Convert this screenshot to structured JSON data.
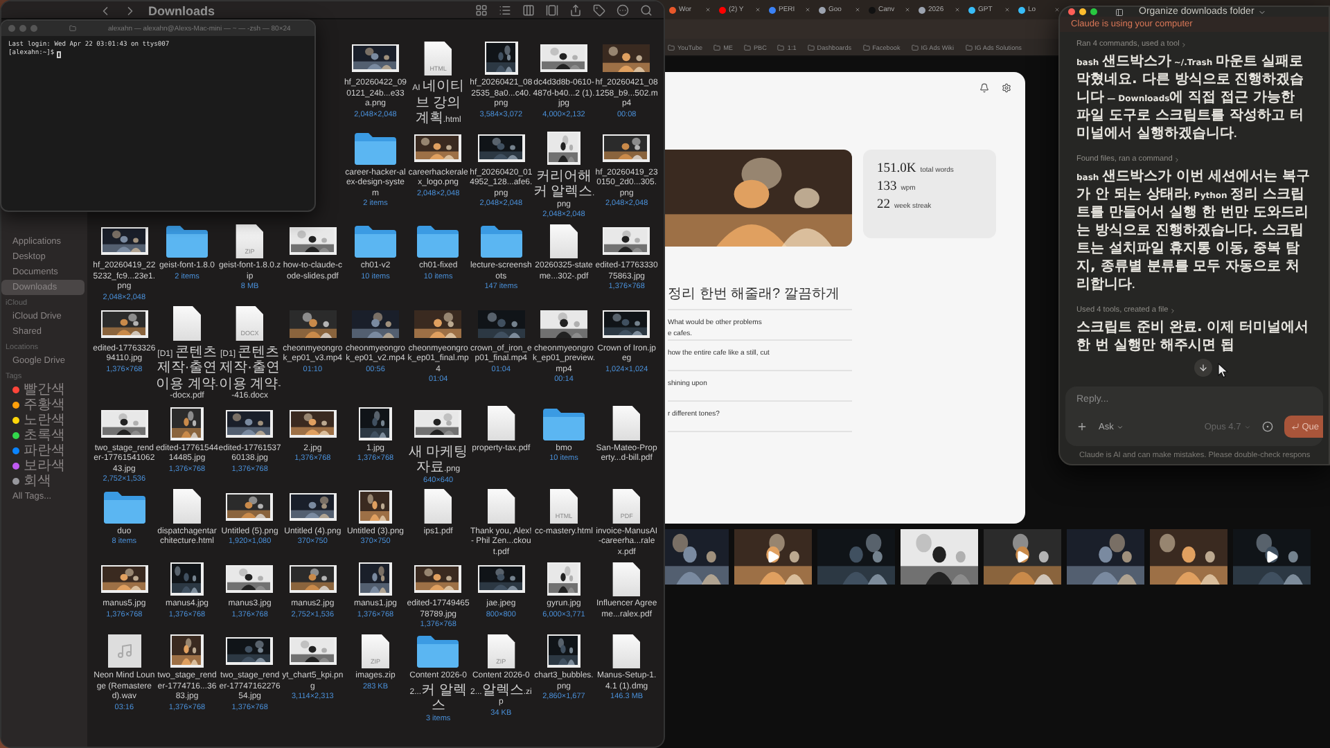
{
  "finder": {
    "title": "Downloads",
    "sidebar": [
      {
        "kind": "item",
        "label": "Applications",
        "selected": false
      },
      {
        "kind": "item",
        "label": "Desktop",
        "selected": false
      },
      {
        "kind": "item",
        "label": "Documents",
        "selected": false
      },
      {
        "kind": "item",
        "label": "Downloads",
        "selected": true
      },
      {
        "kind": "header",
        "label": "iCloud"
      },
      {
        "kind": "item",
        "label": "iCloud Drive",
        "selected": false
      },
      {
        "kind": "item",
        "label": "Shared",
        "selected": false
      },
      {
        "kind": "header",
        "label": "Locations"
      },
      {
        "kind": "item",
        "label": "Google Drive",
        "selected": false
      },
      {
        "kind": "header",
        "label": "Tags"
      },
      {
        "kind": "tag",
        "label": "빨간색",
        "color": "#ff453a"
      },
      {
        "kind": "tag",
        "label": "주황색",
        "color": "#ff9f0a"
      },
      {
        "kind": "tag",
        "label": "노란색",
        "color": "#ffd60a"
      },
      {
        "kind": "tag",
        "label": "초록색",
        "color": "#32d74b"
      },
      {
        "kind": "tag",
        "label": "파란색",
        "color": "#0a84ff"
      },
      {
        "kind": "tag",
        "label": "보라색",
        "color": "#bf5af2"
      },
      {
        "kind": "tag",
        "label": "회색",
        "color": "#98989d"
      },
      {
        "kind": "item",
        "label": "All Tags...",
        "selected": false
      }
    ],
    "rows": [
      {
        "items": [
          {
            "name": "hf_20260422_090121_24b...e33a.png",
            "meta": "2,048×2,048"
          },
          {
            "kind": "doc",
            "name": "AI 네이티브 강의 계획.html",
            "badge": "HTML"
          },
          {
            "name": "hf_20260421_082535_8a0...c40.png",
            "meta": "3,584×3,072"
          },
          {
            "name": "dc4d3d8b-0610-487d-b40...2 (1).jpg",
            "meta": "4,000×2,132"
          },
          {
            "kind": "video",
            "name": "hf_20260421_081258_b9...502.mp4",
            "meta": "00:08"
          }
        ]
      },
      {
        "items": [
          {
            "kind": "folder",
            "name": "career-hacker-alex-design-system",
            "meta": "2 items"
          },
          {
            "name": "careerhackeralex_logo.png",
            "meta": "2,048×2,048"
          },
          {
            "name": "hf_20260420_014952_128...afe6.png",
            "meta": "2,048×2,048"
          },
          {
            "name": "커리어해커 알렉스.png",
            "meta": "2,048×2,048"
          },
          {
            "name": "hf_20260419_230150_2d0...305.png",
            "meta": "2,048×2,048"
          }
        ]
      },
      {
        "items": [
          {
            "name": "hf_20260419_225232_fc9...23e1.png",
            "meta": "2,048×2,048"
          },
          {
            "kind": "folder",
            "name": "geist-font-1.8.0",
            "meta": "2 items"
          },
          {
            "kind": "doc",
            "name": "geist-font-1.8.0.zip",
            "badge": "ZIP",
            "meta": "8 MB"
          },
          {
            "name": "how-to-claude-code-slides.pdf"
          },
          {
            "kind": "folder",
            "name": "ch01-v2",
            "meta": "10 items"
          },
          {
            "kind": "folder",
            "name": "ch01-fixed",
            "meta": "10 items"
          },
          {
            "kind": "folder",
            "name": "lecture-screenshots",
            "meta": "147 items"
          },
          {
            "kind": "doc",
            "name": "20260325-stateme...302-.pdf"
          },
          {
            "name": "edited-1776333075863.jpg",
            "meta": "1,376×768"
          }
        ]
      },
      {
        "items": [
          {
            "name": "edited-1776332694110.jpg",
            "meta": "1,376×768"
          },
          {
            "kind": "doc",
            "name": "[D1] 콘텐츠 제작·출연 이용 계약--docx.pdf"
          },
          {
            "kind": "doc",
            "name": "[D1] 콘텐츠 제작·출연 이용 계약--416.docx",
            "badge": "DOCX"
          },
          {
            "kind": "video",
            "name": "cheonmyeongrok_ep01_v3.mp4",
            "meta": "01:10"
          },
          {
            "kind": "video",
            "name": "cheonmyeongrok_ep01_v2.mp4",
            "meta": "00:56"
          },
          {
            "kind": "video",
            "name": "cheonmyeongrok_ep01_final.mp4",
            "meta": "01:04"
          },
          {
            "kind": "video",
            "name": "crown_of_iron_ep01_final.mp4",
            "meta": "01:04"
          },
          {
            "kind": "video",
            "name": "cheonmyeongrok_ep01_preview.mp4",
            "meta": "00:14"
          },
          {
            "name": "Crown of Iron.jpeg",
            "meta": "1,024×1,024"
          }
        ]
      },
      {
        "items": [
          {
            "name": "two_stage_render-1776154106243.jpg",
            "meta": "2,752×1,536"
          },
          {
            "name": "edited-1776154414485.jpg",
            "meta": "1,376×768"
          },
          {
            "name": "edited-1776153760138.jpg",
            "meta": "1,376×768"
          },
          {
            "name": "2.jpg",
            "meta": "1,376×768"
          },
          {
            "name": "1.jpg",
            "meta": "1,376×768"
          },
          {
            "name": "새 마케팅 자료.png",
            "meta": "640×640"
          },
          {
            "kind": "doc",
            "name": "property-tax.pdf"
          },
          {
            "kind": "folder",
            "name": "bmo",
            "meta": "10 items"
          },
          {
            "kind": "doc",
            "name": "San-Mateo-Property...d-bill.pdf"
          }
        ]
      },
      {
        "items": [
          {
            "kind": "folder",
            "name": "duo",
            "meta": "8 items"
          },
          {
            "kind": "doc",
            "name": "dispatchagentarchitecture.html"
          },
          {
            "name": "Untitled (5).png",
            "meta": "1,920×1,080"
          },
          {
            "name": "Untitled (4).png",
            "meta": "370×750"
          },
          {
            "name": "Untitled (3).png",
            "meta": "370×750"
          },
          {
            "kind": "doc",
            "name": "ips1.pdf"
          },
          {
            "kind": "doc",
            "name": "Thank you, Alex! - Phil Zen...ckout.pdf"
          },
          {
            "kind": "doc",
            "name": "cc-mastery.html",
            "badge": "HTML"
          },
          {
            "kind": "doc",
            "name": "invoice-ManusAI-careerha...ralex.pdf",
            "badge": "PDF"
          }
        ]
      },
      {
        "items": [
          {
            "name": "manus5.jpg",
            "meta": "1,376×768"
          },
          {
            "name": "manus4.jpg",
            "meta": "1,376×768"
          },
          {
            "name": "manus3.jpg",
            "meta": "1,376×768"
          },
          {
            "name": "manus2.jpg",
            "meta": "2,752×1,536"
          },
          {
            "name": "manus1.jpg",
            "meta": "1,376×768"
          },
          {
            "name": "edited-1774946578789.jpg",
            "meta": "1,376×768"
          },
          {
            "name": "jae.jpeg",
            "meta": "800×800"
          },
          {
            "name": "gyrun.jpg",
            "meta": "6,000×3,771"
          },
          {
            "kind": "doc",
            "name": "Influencer Agreeme...ralex.pdf"
          }
        ]
      },
      {
        "items": [
          {
            "kind": "audio",
            "name": "Neon Mind Lounge (Remastered).wav",
            "meta": "03:16"
          },
          {
            "name": "two_stage_render-1774716...3683.jpg",
            "meta": "1,376×768"
          },
          {
            "name": "two_stage_render-1774716227654.jpg",
            "meta": "1,376×768"
          },
          {
            "name": "yt_chart5_kpi.png",
            "meta": "3,114×2,313"
          },
          {
            "kind": "doc",
            "name": "images.zip",
            "badge": "ZIP",
            "meta": "283 KB"
          },
          {
            "kind": "folder",
            "name": "Content 2026-02...커 알렉스",
            "meta": "3 items"
          },
          {
            "kind": "doc",
            "name": "Content 2026-02...알렉스.zip",
            "badge": "ZIP",
            "meta": "34 KB"
          },
          {
            "name": "chart3_bubbles.png",
            "meta": "2,860×1,677"
          },
          {
            "kind": "doc",
            "name": "Manus-Setup-1.4.1 (1).dmg",
            "meta": "146.3 MB"
          }
        ]
      }
    ]
  },
  "terminal": {
    "title": "alexahn — alexahn@Alexs-Mac-mini — ~ — -zsh — 80×24",
    "lines": [
      "Last login: Wed Apr 22 03:01:43 on ttys007",
      "[alexahn:~]$"
    ]
  },
  "browser": {
    "tabs": [
      {
        "label": "Wor",
        "color": "#e8572a"
      },
      {
        "label": "(2) Y",
        "color": "#ff0000"
      },
      {
        "label": "PERI",
        "color": "#3b82f6"
      },
      {
        "label": "Goo",
        "color": "#9ca3af"
      },
      {
        "label": "Canv",
        "color": "#111111"
      },
      {
        "label": "2026",
        "color": "#9ca3af"
      },
      {
        "label": "GPT",
        "color": "#38bdf8"
      },
      {
        "label": "Lo",
        "color": "#38bdf8"
      }
    ],
    "bookmarks": [
      "YouTube",
      "ME",
      "PBC",
      "1:1",
      "Dashboards",
      "Facebook",
      "IG Ads Wiki",
      "IG Ads Solutions"
    ],
    "stats": [
      {
        "value": "151.0K",
        "unit": "total words"
      },
      {
        "value": "133",
        "unit": "wpm"
      },
      {
        "value": "22",
        "unit": "week streak"
      }
    ],
    "prompts": [
      {
        "lines": [
          "정리 한번 해줄래? 깔끔하게"
        ]
      },
      {
        "lines": [
          "What would be other problems",
          "e cafes."
        ]
      },
      {
        "lines": [
          "how the entire cafe like a still, cut"
        ]
      },
      {
        "lines": [
          "shining upon"
        ]
      },
      {
        "lines": [
          "r different tones?"
        ]
      }
    ]
  },
  "claude": {
    "title": "Organize downloads folder",
    "banner": "Claude is using your computer",
    "messages": [
      {
        "summary": "Ran 4 commands, used a tool",
        "text": "bash 샌드박스가 ~/.Trash 마운트 실패로 막혔네요. 다른 방식으로 진행하겠습니다 — Downloads에 직접 접근 가능한 파일 도구로 스크립트를 작성하고 터미널에서 실행하겠습니다."
      },
      {
        "summary": "Found files, ran a command",
        "text": "bash 샌드박스가 이번 세션에서는 복구가 안 되는 상태라, Python 정리 스크립트를 만들어서 실행 한 번만 도와드리는 방식으로 진행하겠습니다. 스크립트는 설치파일 휴지통 이동, 중복 탐지, 종류별 분류를 모두 자동으로 처리합니다."
      },
      {
        "summary": "Used 4 tools, created a file",
        "text": "스크립트 준비 완료. 이제 터미널에서 한 번 실행만 해주시면 됩"
      }
    ],
    "input": {
      "placeholder": "Reply..."
    },
    "mode": "Ask",
    "model": "Opus 4.7",
    "send": "Que",
    "footer": "Claude is AI and can make mistakes. Please double-check respons"
  }
}
